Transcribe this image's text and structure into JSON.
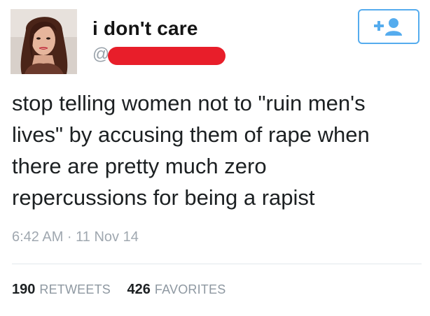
{
  "tweet": {
    "display_name": "i don't care",
    "handle_prefix": "@",
    "text": "stop telling women not to \"ruin men's\nlives\" by accusing them of rape when\nthere are pretty much zero\nrepercussions for being a rapist",
    "timestamp": "6:42 AM · 11 Nov 14",
    "stats": {
      "retweets_count": "190",
      "retweets_label": "RETWEETS",
      "favorites_count": "426",
      "favorites_label": "FAVORITES"
    },
    "follow_button_icon": "add-user-icon"
  },
  "colors": {
    "accent": "#55acee",
    "redaction": "#e81e2a",
    "text": "#1c2022",
    "muted": "#a0a8b0"
  }
}
